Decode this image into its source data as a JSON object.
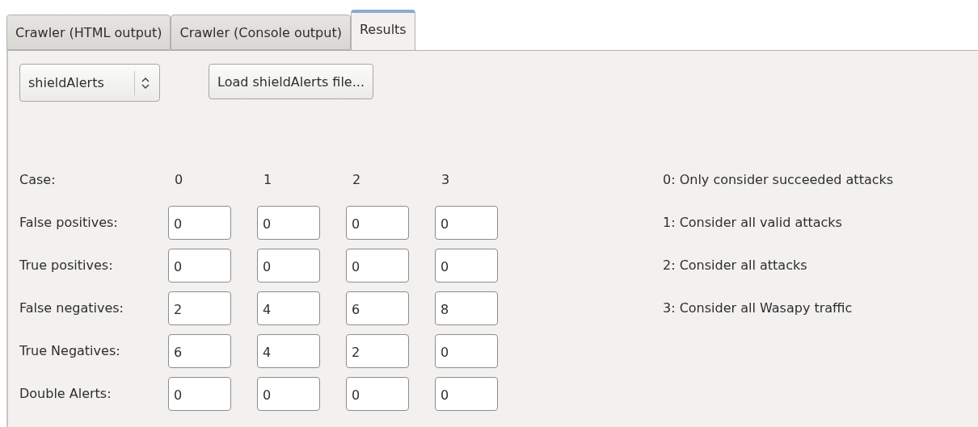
{
  "tabs": [
    {
      "label": "Crawler (HTML output)",
      "selected": false
    },
    {
      "label": "Crawler (Console output)",
      "selected": false
    },
    {
      "label": "Results",
      "selected": true
    }
  ],
  "toolbar": {
    "combo": {
      "value": "shieldAlerts"
    },
    "load_button": "Load shieldAlerts file..."
  },
  "table": {
    "corner": "Case:",
    "columns": [
      "0",
      "1",
      "2",
      "3"
    ],
    "rows": [
      {
        "label": "False positives:",
        "values": [
          "0",
          "0",
          "0",
          "0"
        ]
      },
      {
        "label": "True positives:",
        "values": [
          "0",
          "0",
          "0",
          "0"
        ]
      },
      {
        "label": "False negatives:",
        "values": [
          "2",
          "4",
          "6",
          "8"
        ]
      },
      {
        "label": "True Negatives:",
        "values": [
          "6",
          "4",
          "2",
          "0"
        ]
      },
      {
        "label": "Double Alerts:",
        "values": [
          "0",
          "0",
          "0",
          "0"
        ]
      }
    ]
  },
  "legend": [
    "0: Only consider succeeded attacks",
    "1: Consider all valid attacks",
    "2: Consider all attacks",
    "3: Consider all Wasapy traffic"
  ]
}
